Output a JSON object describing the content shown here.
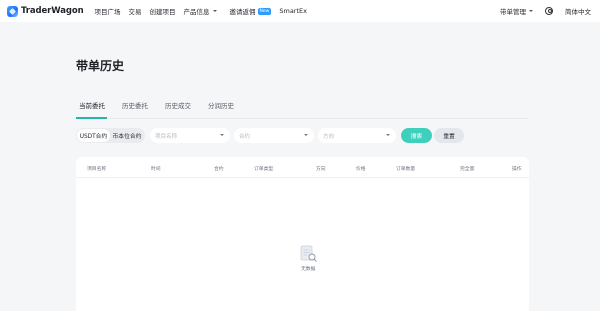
{
  "header": {
    "brand": "TraderWagon",
    "nav": [
      "项目广场",
      "交易",
      "创建项目",
      "产品信息",
      "邀请返佣",
      "SmartEx"
    ],
    "new_badge": "New",
    "right": {
      "lead_mgmt": "带单管理",
      "lang": "简体中文"
    }
  },
  "page": {
    "title": "带单历史",
    "tabs": [
      "当前委托",
      "历史委托",
      "历史成交",
      "分润历史"
    ],
    "active_tab": "当前委托"
  },
  "filters": {
    "segment": [
      "USDT合约",
      "币本位合约"
    ],
    "selects": [
      "项目名称",
      "合约",
      "方向"
    ],
    "search_label": "搜索",
    "reset_label": "重置"
  },
  "table": {
    "columns": [
      "项目名称",
      "时间",
      "合约",
      "订单类型",
      "方向",
      "价格",
      "订单数量",
      "完全量",
      "操作"
    ],
    "empty_text": "无数据"
  },
  "colors": {
    "accent": "#3fd0bd",
    "tab_underline": "#27b5a8",
    "badge": "#2f9cff"
  }
}
